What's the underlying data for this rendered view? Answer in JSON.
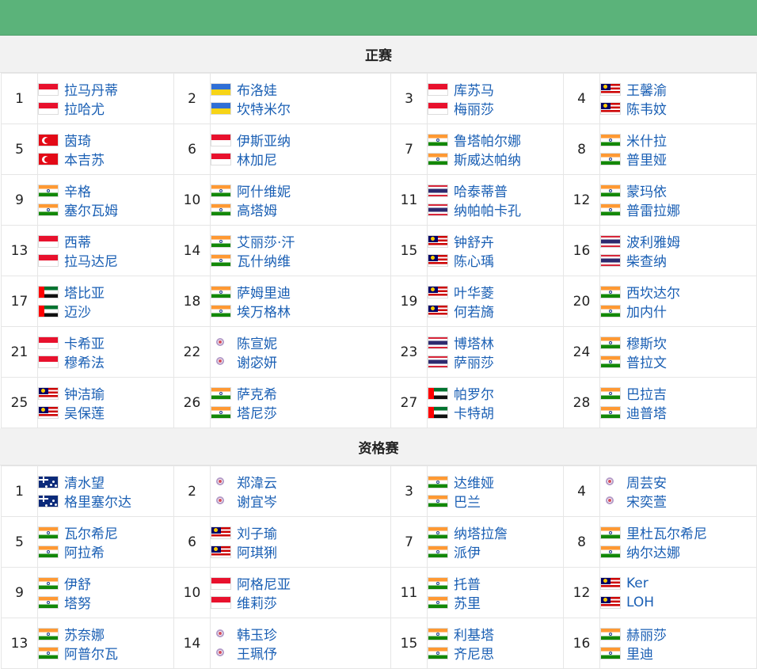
{
  "sections": [
    {
      "title": "正赛",
      "rows": [
        [
          {
            "num": "1",
            "p1": {
              "flag": "id",
              "name": "拉马丹蒂"
            },
            "p2": {
              "flag": "id",
              "name": "拉哈尤"
            }
          },
          {
            "num": "2",
            "p1": {
              "flag": "ua",
              "name": "布洛娃"
            },
            "p2": {
              "flag": "ua",
              "name": "坎特米尔"
            }
          },
          {
            "num": "3",
            "p1": {
              "flag": "id",
              "name": "库苏马"
            },
            "p2": {
              "flag": "id",
              "name": "梅丽莎"
            }
          },
          {
            "num": "4",
            "p1": {
              "flag": "my",
              "name": "王馨渝"
            },
            "p2": {
              "flag": "my",
              "name": "陈韦妏"
            }
          }
        ],
        [
          {
            "num": "5",
            "p1": {
              "flag": "tr",
              "name": "茵琦"
            },
            "p2": {
              "flag": "tr",
              "name": "本吉苏"
            }
          },
          {
            "num": "6",
            "p1": {
              "flag": "id",
              "name": "伊斯亚纳"
            },
            "p2": {
              "flag": "id",
              "name": "林加尼"
            }
          },
          {
            "num": "7",
            "p1": {
              "flag": "in",
              "name": "鲁塔帕尔娜"
            },
            "p2": {
              "flag": "in",
              "name": "斯威达帕纳"
            }
          },
          {
            "num": "8",
            "p1": {
              "flag": "in",
              "name": "米什拉"
            },
            "p2": {
              "flag": "in",
              "name": "普里娅"
            }
          }
        ],
        [
          {
            "num": "9",
            "p1": {
              "flag": "in",
              "name": "辛格"
            },
            "p2": {
              "flag": "in",
              "name": "塞尔瓦姆"
            }
          },
          {
            "num": "10",
            "p1": {
              "flag": "in",
              "name": "阿什维妮"
            },
            "p2": {
              "flag": "in",
              "name": "高塔姆"
            }
          },
          {
            "num": "11",
            "p1": {
              "flag": "th",
              "name": "哈泰蒂普"
            },
            "p2": {
              "flag": "th",
              "name": "纳帕帕卡孔"
            }
          },
          {
            "num": "12",
            "p1": {
              "flag": "in",
              "name": "蒙玛依"
            },
            "p2": {
              "flag": "in",
              "name": "普雷拉娜"
            }
          }
        ],
        [
          {
            "num": "13",
            "p1": {
              "flag": "id",
              "name": "西蒂"
            },
            "p2": {
              "flag": "id",
              "name": "拉马达尼"
            }
          },
          {
            "num": "14",
            "p1": {
              "flag": "in",
              "name": "艾丽莎·汗"
            },
            "p2": {
              "flag": "in",
              "name": "瓦什纳维"
            }
          },
          {
            "num": "15",
            "p1": {
              "flag": "my",
              "name": "钟舒卉"
            },
            "p2": {
              "flag": "my",
              "name": "陈心瑀"
            }
          },
          {
            "num": "16",
            "p1": {
              "flag": "th",
              "name": "波利雅姆"
            },
            "p2": {
              "flag": "th",
              "name": "柴查纳"
            }
          }
        ],
        [
          {
            "num": "17",
            "p1": {
              "flag": "ae",
              "name": "塔比亚"
            },
            "p2": {
              "flag": "ae",
              "name": "迈沙"
            }
          },
          {
            "num": "18",
            "p1": {
              "flag": "in",
              "name": "萨姆里迪"
            },
            "p2": {
              "flag": "in",
              "name": "埃万格林"
            }
          },
          {
            "num": "19",
            "p1": {
              "flag": "my",
              "name": "叶华菱"
            },
            "p2": {
              "flag": "my",
              "name": "何若旖"
            }
          },
          {
            "num": "20",
            "p1": {
              "flag": "in",
              "name": "西坎达尔"
            },
            "p2": {
              "flag": "in",
              "name": "加内什"
            }
          }
        ],
        [
          {
            "num": "21",
            "p1": {
              "flag": "id",
              "name": "卡希亚"
            },
            "p2": {
              "flag": "id",
              "name": "穆希法"
            }
          },
          {
            "num": "22",
            "p1": {
              "flag": "tpe",
              "name": "陈宣妮"
            },
            "p2": {
              "flag": "tpe",
              "name": "谢宓妍"
            }
          },
          {
            "num": "23",
            "p1": {
              "flag": "th",
              "name": "博塔林"
            },
            "p2": {
              "flag": "th",
              "name": "萨丽莎"
            }
          },
          {
            "num": "24",
            "p1": {
              "flag": "in",
              "name": "穆斯坎"
            },
            "p2": {
              "flag": "in",
              "name": "普拉文"
            }
          }
        ],
        [
          {
            "num": "25",
            "p1": {
              "flag": "my",
              "name": "钟洁瑜"
            },
            "p2": {
              "flag": "my",
              "name": "吴保莲"
            }
          },
          {
            "num": "26",
            "p1": {
              "flag": "in",
              "name": "萨克希"
            },
            "p2": {
              "flag": "in",
              "name": "塔尼莎"
            }
          },
          {
            "num": "27",
            "p1": {
              "flag": "ae",
              "name": "帕罗尔"
            },
            "p2": {
              "flag": "ae",
              "name": "卡特胡"
            }
          },
          {
            "num": "28",
            "p1": {
              "flag": "in",
              "name": "巴拉吉"
            },
            "p2": {
              "flag": "in",
              "name": "迪普塔"
            }
          }
        ]
      ]
    },
    {
      "title": "资格赛",
      "rows": [
        [
          {
            "num": "1",
            "p1": {
              "flag": "au",
              "name": "清水望"
            },
            "p2": {
              "flag": "au",
              "name": "格里塞尔达"
            }
          },
          {
            "num": "2",
            "p1": {
              "flag": "tpe",
              "name": "郑湋云"
            },
            "p2": {
              "flag": "tpe",
              "name": "谢宜岑"
            }
          },
          {
            "num": "3",
            "p1": {
              "flag": "in",
              "name": "达维娅"
            },
            "p2": {
              "flag": "in",
              "name": "巴兰"
            }
          },
          {
            "num": "4",
            "p1": {
              "flag": "tpe",
              "name": "周芸安"
            },
            "p2": {
              "flag": "tpe",
              "name": "宋奕萱"
            }
          }
        ],
        [
          {
            "num": "5",
            "p1": {
              "flag": "in",
              "name": "瓦尔希尼"
            },
            "p2": {
              "flag": "in",
              "name": "阿拉希"
            }
          },
          {
            "num": "6",
            "p1": {
              "flag": "my",
              "name": "刘子瑜"
            },
            "p2": {
              "flag": "my",
              "name": "阿琪猁"
            }
          },
          {
            "num": "7",
            "p1": {
              "flag": "in",
              "name": "纳塔拉詹"
            },
            "p2": {
              "flag": "in",
              "name": "派伊"
            }
          },
          {
            "num": "8",
            "p1": {
              "flag": "in",
              "name": "里杜瓦尔希尼"
            },
            "p2": {
              "flag": "in",
              "name": "纳尔达娜"
            }
          }
        ],
        [
          {
            "num": "9",
            "p1": {
              "flag": "in",
              "name": "伊舒"
            },
            "p2": {
              "flag": "in",
              "name": "塔努"
            }
          },
          {
            "num": "10",
            "p1": {
              "flag": "id",
              "name": "阿格尼亚"
            },
            "p2": {
              "flag": "id",
              "name": "维莉莎"
            }
          },
          {
            "num": "11",
            "p1": {
              "flag": "in",
              "name": "托普"
            },
            "p2": {
              "flag": "in",
              "name": "苏里"
            }
          },
          {
            "num": "12",
            "p1": {
              "flag": "my",
              "name": "Ker"
            },
            "p2": {
              "flag": "my",
              "name": "LOH"
            }
          }
        ],
        [
          {
            "num": "13",
            "p1": {
              "flag": "in",
              "name": "苏奈娜"
            },
            "p2": {
              "flag": "in",
              "name": "阿普尔瓦"
            }
          },
          {
            "num": "14",
            "p1": {
              "flag": "tpe",
              "name": "韩玉珍"
            },
            "p2": {
              "flag": "tpe",
              "name": "王珮伃"
            }
          },
          {
            "num": "15",
            "p1": {
              "flag": "in",
              "name": "利基塔"
            },
            "p2": {
              "flag": "in",
              "name": "齐尼思"
            }
          },
          {
            "num": "16",
            "p1": {
              "flag": "in",
              "name": "赫丽莎"
            },
            "p2": {
              "flag": "in",
              "name": "里迪"
            }
          }
        ]
      ]
    }
  ]
}
